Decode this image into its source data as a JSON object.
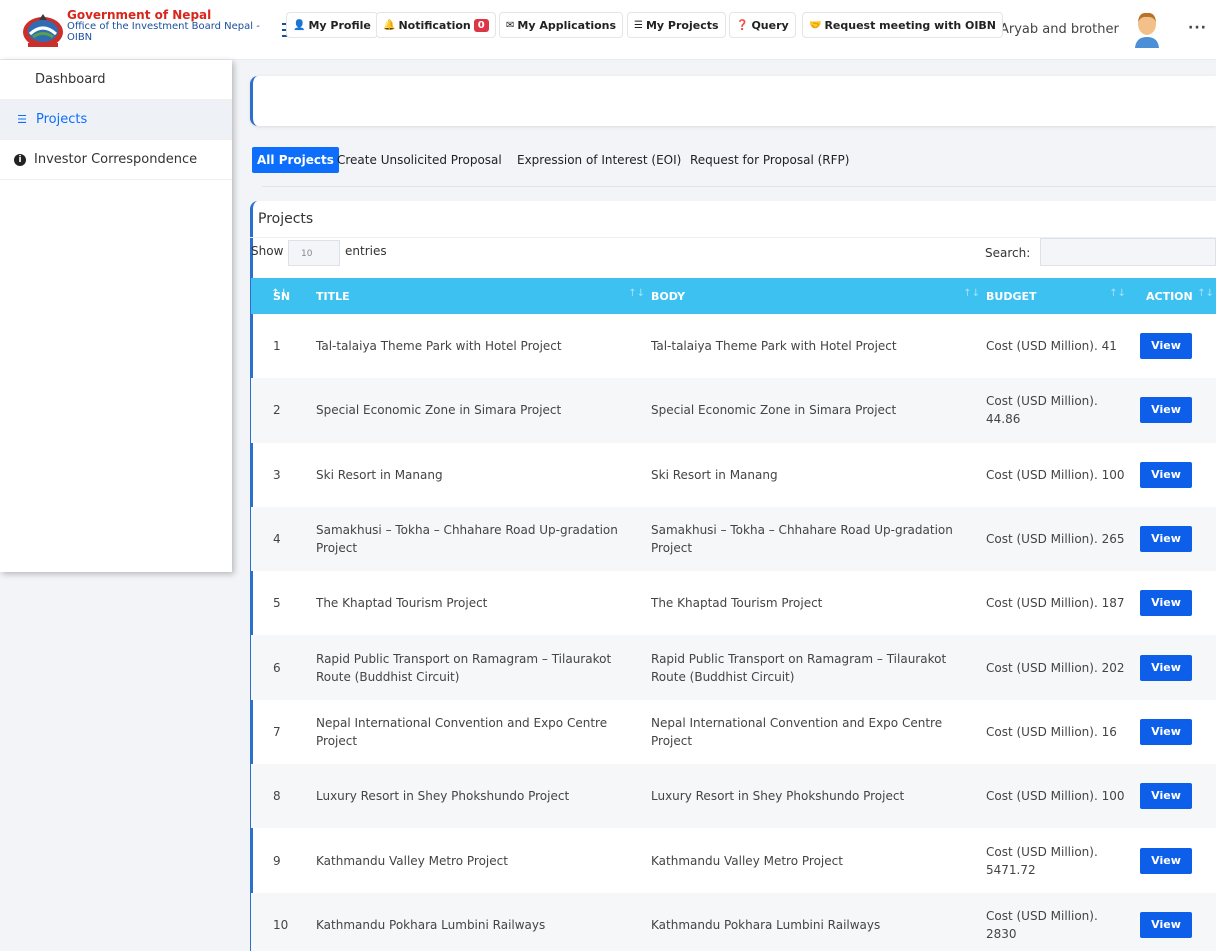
{
  "header": {
    "brand_line1": "Government of Nepal",
    "brand_line2": "Office of the Investment Board Nepal -",
    "brand_line3": "OIBN",
    "user_name": "Aryab and brother",
    "more_label": "···"
  },
  "sidebar": {
    "items": [
      {
        "label": "Dashboard",
        "icon": "none"
      },
      {
        "label": "Projects",
        "icon": "list-icon"
      },
      {
        "label": "Investor Correspondence",
        "icon": "info-icon"
      }
    ]
  },
  "actions": {
    "my_profile": "My Profile",
    "notification": "Notification",
    "notification_count": "0",
    "my_applications": "My Applications",
    "my_projects": "My Projects",
    "query": "Query",
    "request_meeting": "Request meeting with OIBN"
  },
  "tabs": {
    "all_projects": "All Projects",
    "create_unsolicited": "Create Unsolicited Proposal",
    "eoi": "Expression of Interest (EOI)",
    "rfp": "Request for Proposal (RFP)"
  },
  "projects": {
    "title": "Projects",
    "show_label": "Show",
    "entries_value": "10",
    "entries_label": "entries",
    "search_label": "Search:",
    "columns": {
      "sn": "SN",
      "title": "TITLE",
      "body": "BODY",
      "budget": "BUDGET",
      "action": "ACTION"
    },
    "view_label": "View",
    "rows": [
      {
        "sn": "1",
        "title": "Tal-talaiya Theme Park with Hotel Project",
        "body": "Tal-talaiya Theme Park with Hotel Project",
        "budget": "Cost (USD Million). 41"
      },
      {
        "sn": "2",
        "title": "Special Economic Zone in Simara Project",
        "body": "Special Economic Zone in Simara Project",
        "budget": "Cost (USD Million). 44.86"
      },
      {
        "sn": "3",
        "title": "Ski Resort in Manang",
        "body": "Ski Resort in Manang",
        "budget": "Cost (USD Million). 100"
      },
      {
        "sn": "4",
        "title": "Samakhusi – Tokha – Chhahare Road Up-gradation Project",
        "body": "Samakhusi – Tokha – Chhahare Road Up-gradation Project",
        "budget": "Cost (USD Million). 265"
      },
      {
        "sn": "5",
        "title": "The Khaptad Tourism Project",
        "body": "The Khaptad Tourism Project",
        "budget": "Cost (USD Million). 187"
      },
      {
        "sn": "6",
        "title": "Rapid Public Transport on Ramagram – Tilaurakot Route (Buddhist Circuit)",
        "body": "Rapid Public Transport on Ramagram – Tilaurakot Route (Buddhist Circuit)",
        "budget": "Cost (USD Million). 202"
      },
      {
        "sn": "7",
        "title": "Nepal International Convention and Expo Centre Project",
        "body": "Nepal International Convention and Expo Centre Project",
        "budget": "Cost (USD Million). 16"
      },
      {
        "sn": "8",
        "title": "Luxury Resort in Shey Phokshundo Project",
        "body": "Luxury Resort in Shey Phokshundo Project",
        "budget": "Cost (USD Million). 100"
      },
      {
        "sn": "9",
        "title": "Kathmandu Valley Metro Project",
        "body": "Kathmandu Valley Metro Project",
        "budget": "Cost (USD Million). 5471.72"
      },
      {
        "sn": "10",
        "title": "Kathmandu Pokhara Lumbini Railways",
        "body": "Kathmandu Pokhara Lumbini Railways",
        "budget": "Cost (USD Million). 2830"
      }
    ]
  },
  "colors": {
    "primary": "#0d6efd",
    "table_header": "#3dc1f0",
    "brand_red": "#d9261c",
    "brand_blue": "#1a4fa0"
  }
}
